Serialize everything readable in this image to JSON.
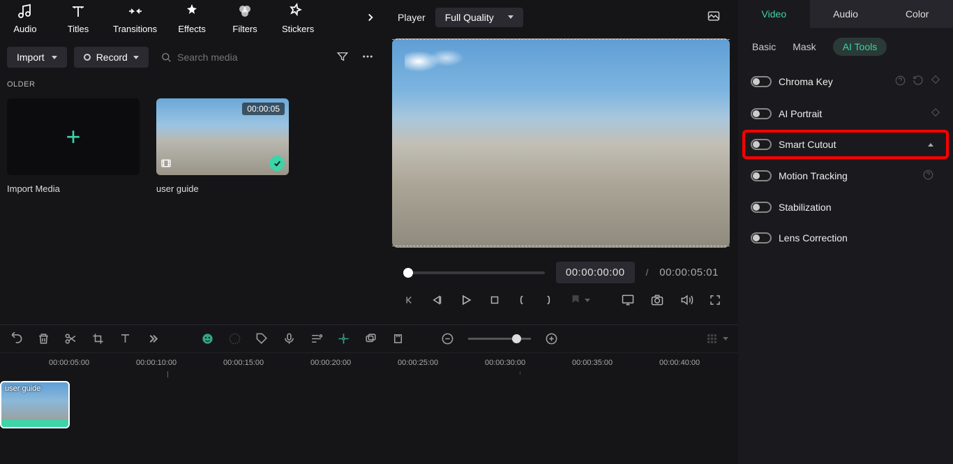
{
  "toolbar": {
    "items": [
      "Audio",
      "Titles",
      "Transitions",
      "Effects",
      "Filters",
      "Stickers"
    ]
  },
  "subToolbar": {
    "import": "Import",
    "record": "Record",
    "searchPlaceholder": "Search media"
  },
  "mediaSection": {
    "folderLabel": "OLDER",
    "importLabel": "Import Media",
    "clipLabel": "user guide",
    "clipDuration": "00:00:05"
  },
  "player": {
    "title": "Player",
    "quality": "Full Quality",
    "currentTime": "00:00:00:00",
    "duration": "00:00:05:01"
  },
  "rightPanel": {
    "topTabs": [
      "Video",
      "Audio",
      "Color"
    ],
    "subTabs": [
      "Basic",
      "Mask",
      "AI Tools"
    ],
    "aiItems": [
      {
        "label": "Chroma Key",
        "help": true,
        "reset": true,
        "diamond": true
      },
      {
        "label": "AI Portrait",
        "help": false,
        "reset": false,
        "diamond": true
      },
      {
        "label": "Smart Cutout",
        "help": false,
        "reset": false,
        "diamond": false,
        "highlighted": true,
        "expandable": true
      },
      {
        "label": "Motion Tracking",
        "help": true,
        "reset": false,
        "diamond": false
      },
      {
        "label": "Stabilization",
        "help": false,
        "reset": false,
        "diamond": false
      },
      {
        "label": "Lens Correction",
        "help": false,
        "reset": false,
        "diamond": false
      }
    ]
  },
  "timeline": {
    "marks": [
      "00:00:05:00",
      "00:00:10:00",
      "00:00:15:00",
      "00:00:20:00",
      "00:00:25:00",
      "00:00:30:00",
      "00:00:35:00",
      "00:00:40:00"
    ],
    "clipLabel": "user guide"
  }
}
